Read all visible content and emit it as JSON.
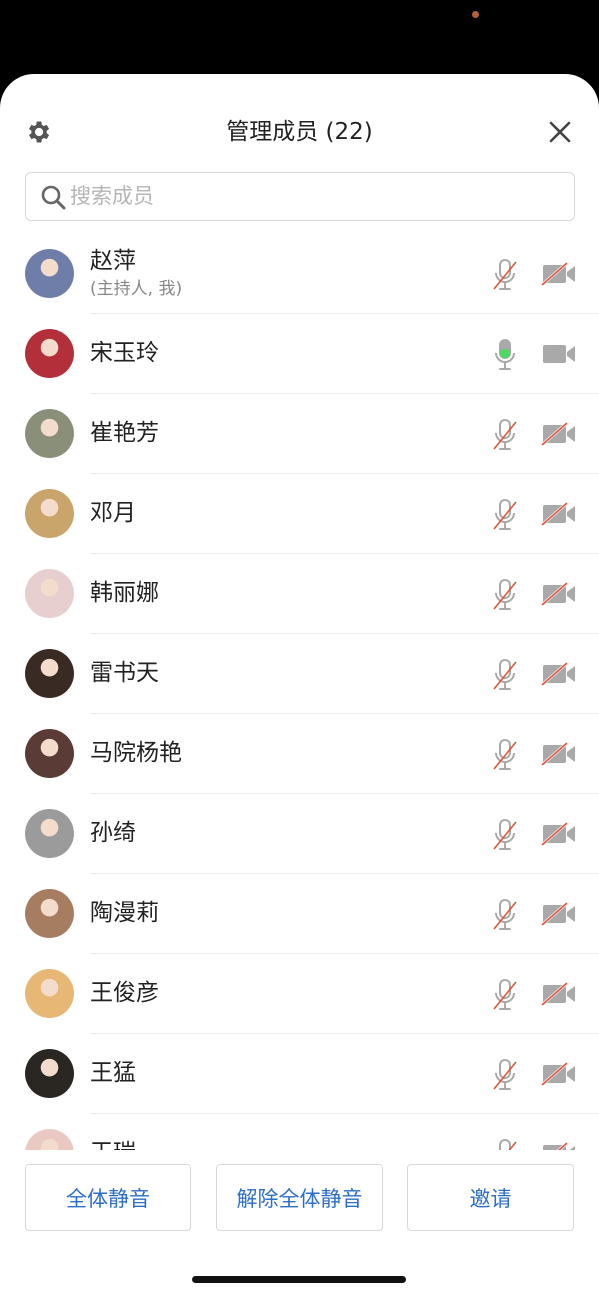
{
  "header": {
    "title": "管理成员 (22)",
    "settings_icon": "gear-icon",
    "close_icon": "close-icon"
  },
  "search": {
    "placeholder": "搜索成员",
    "value": ""
  },
  "members": [
    {
      "name": "赵萍",
      "subtitle": "(主持人, 我)",
      "mic": "muted",
      "camera": "off",
      "avatar_color": "#6e7ea8"
    },
    {
      "name": "宋玉玲",
      "subtitle": "",
      "mic": "active",
      "camera": "on",
      "avatar_color": "#b3303a"
    },
    {
      "name": "崔艳芳",
      "subtitle": "",
      "mic": "muted",
      "camera": "off",
      "avatar_color": "#8a8f7a"
    },
    {
      "name": "邓月",
      "subtitle": "",
      "mic": "muted",
      "camera": "off",
      "avatar_color": "#c9a56b"
    },
    {
      "name": "韩丽娜",
      "subtitle": "",
      "mic": "muted",
      "camera": "off",
      "avatar_color": "#e8cfcf"
    },
    {
      "name": "雷书天",
      "subtitle": "",
      "mic": "muted",
      "camera": "off",
      "avatar_color": "#3a2a24"
    },
    {
      "name": "马院杨艳",
      "subtitle": "",
      "mic": "muted",
      "camera": "off",
      "avatar_color": "#5b3b36"
    },
    {
      "name": "孙绮",
      "subtitle": "",
      "mic": "muted",
      "camera": "off",
      "avatar_color": "#9b9b9b"
    },
    {
      "name": "陶漫莉",
      "subtitle": "",
      "mic": "muted",
      "camera": "off",
      "avatar_color": "#a77d62"
    },
    {
      "name": "王俊彦",
      "subtitle": "",
      "mic": "muted",
      "camera": "off",
      "avatar_color": "#e7b776"
    },
    {
      "name": "王猛",
      "subtitle": "",
      "mic": "muted",
      "camera": "off",
      "avatar_color": "#2a2622"
    },
    {
      "name": "王瑞",
      "subtitle": "",
      "mic": "muted",
      "camera": "off",
      "avatar_color": "#e9c9c2"
    }
  ],
  "footer": {
    "mute_all": "全体静音",
    "unmute_all": "解除全体静音",
    "invite": "邀请"
  },
  "colors": {
    "accent_blue": "#2d6ec6",
    "mic_active_green": "#4cd964",
    "muted_slash_red": "#e0533d",
    "icon_gray": "#a9a9a9"
  }
}
